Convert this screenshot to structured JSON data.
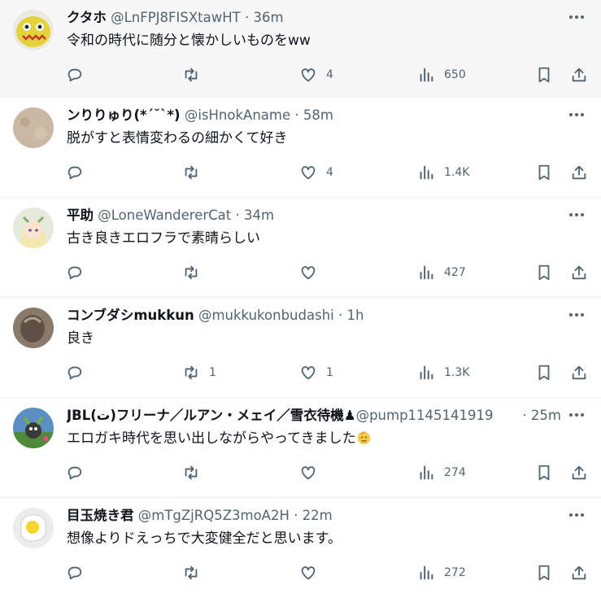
{
  "tweets": [
    {
      "name": "クタホ",
      "handle": "@LnFPJ8FISXtawHT",
      "sep": "·",
      "time": "36m",
      "text": "令和の時代に随分と懐かしいものをww",
      "replies": "",
      "retweets": "",
      "likes": "4",
      "views": "650",
      "avatar_color": "#e6d93a"
    },
    {
      "name": "ンりりゅり(*´˘`*)",
      "handle": "@isHnokAname",
      "sep": "·",
      "time": "58m",
      "text": "脱がすと表情変わるの細かくて好き",
      "replies": "",
      "retweets": "",
      "likes": "4",
      "views": "1.4K",
      "avatar_color": "#c8b8a3"
    },
    {
      "name": "平助",
      "handle": "@LoneWandererCat",
      "sep": "·",
      "time": "34m",
      "text": "古き良きエロフラで素晴らしい",
      "replies": "",
      "retweets": "",
      "likes": "",
      "views": "427",
      "avatar_color": "#dfe8d6"
    },
    {
      "name": "コンブダシmukkun",
      "handle": "@mukkukonbudashi",
      "sep": "·",
      "time": "1h",
      "text": "良き",
      "replies": "",
      "retweets": "1",
      "likes": "1",
      "views": "1.3K",
      "avatar_color": "#7a6a5c"
    },
    {
      "name": "JBL(ت)フリーナ／ルアン・メェイ／雪衣待機♟",
      "handle": "@pump1145141919",
      "sep": "·",
      "time": "25m",
      "text": "エロガキ時代を思い出しながらやってきました",
      "replies": "",
      "retweets": "",
      "likes": "",
      "views": "274",
      "avatar_color": "#4a7fb5"
    },
    {
      "name": "目玉焼き君",
      "handle": "@mTgZjRQ5Z3moA2H",
      "sep": "·",
      "time": "22m",
      "text": "想像よりドえっちで大変健全だと思います。",
      "replies": "",
      "retweets": "",
      "likes": "",
      "views": "272",
      "avatar_color": "#f5f5f5"
    }
  ],
  "colors": {
    "text": "#0f1419",
    "secondary": "#536471",
    "divider": "#eff3f4",
    "highlight_bg": "#f7f7f7"
  }
}
